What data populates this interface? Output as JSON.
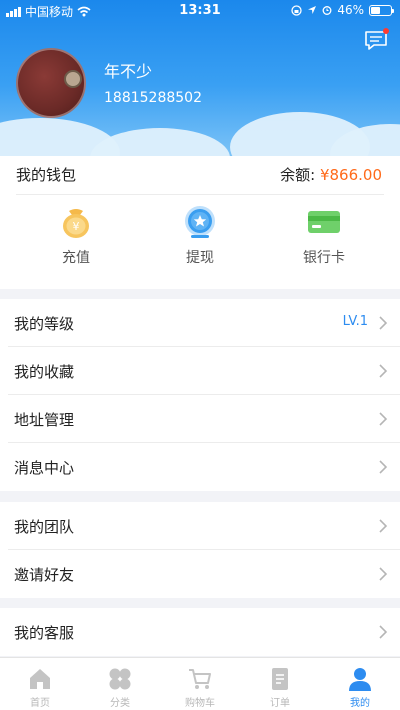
{
  "status_bar": {
    "carrier": "中国移动",
    "time": "13:31",
    "battery": "46%",
    "battery_level": 0.46
  },
  "profile": {
    "name": "年不少",
    "phone": "18815288502"
  },
  "wallet": {
    "title": "我的钱包",
    "balance_label": "余额:",
    "balance_value": "¥866.00",
    "actions": [
      {
        "label": "充值",
        "icon": "coin-bag-icon"
      },
      {
        "label": "提现",
        "icon": "withdraw-star-icon"
      },
      {
        "label": "银行卡",
        "icon": "bank-card-icon"
      }
    ]
  },
  "menu": {
    "group1": [
      {
        "label": "我的等级",
        "value": "LV.1"
      },
      {
        "label": "我的收藏"
      },
      {
        "label": "地址管理"
      },
      {
        "label": "消息中心"
      }
    ],
    "group2": [
      {
        "label": "我的团队"
      },
      {
        "label": "邀请好友"
      }
    ],
    "group3": [
      {
        "label": "我的客服"
      }
    ]
  },
  "tabbar": {
    "active_color": "#2d8cf0",
    "tabs": [
      {
        "label": "首页",
        "icon": "home-icon"
      },
      {
        "label": "分类",
        "icon": "category-icon"
      },
      {
        "label": "购物车",
        "icon": "cart-icon"
      },
      {
        "label": "订单",
        "icon": "order-icon"
      },
      {
        "label": "我的",
        "icon": "profile-icon"
      }
    ]
  },
  "colors": {
    "header": "#1b88ec",
    "accent": "#2d8cf0",
    "balance": "#ff6a1a"
  }
}
